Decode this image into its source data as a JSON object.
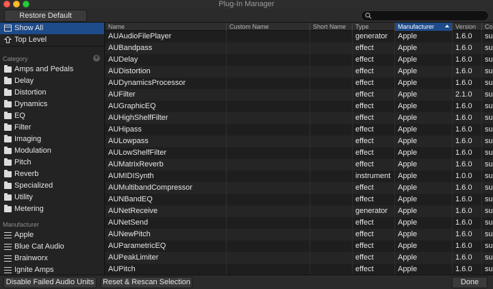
{
  "window": {
    "title": "Plug-In Manager"
  },
  "toolbar": {
    "restore_label": "Restore Default Settings",
    "search_placeholder": ""
  },
  "sidebar": {
    "show_all": "Show All",
    "top_level": "Top Level",
    "category_label": "Category",
    "categories": [
      "Amps and Pedals",
      "Delay",
      "Distortion",
      "Dynamics",
      "EQ",
      "Filter",
      "Imaging",
      "Modulation",
      "Pitch",
      "Reverb",
      "Specialized",
      "Utility",
      "Metering"
    ],
    "manufacturer_label": "Manufacturer",
    "manufacturers": [
      "Apple",
      "Blue Cat Audio",
      "Brainworx",
      "Ignite Amps"
    ]
  },
  "table": {
    "columns": [
      "Name",
      "Custom Name",
      "Short Name",
      "Type",
      "Manufacturer",
      "Version",
      "Co"
    ],
    "sorted_column": "Manufacturer",
    "rows": [
      [
        "AUAudioFilePlayer",
        "",
        "",
        "generator",
        "Apple",
        "1.6.0",
        "suc"
      ],
      [
        "AUBandpass",
        "",
        "",
        "effect",
        "Apple",
        "1.6.0",
        "suc"
      ],
      [
        "AUDelay",
        "",
        "",
        "effect",
        "Apple",
        "1.6.0",
        "suc"
      ],
      [
        "AUDistortion",
        "",
        "",
        "effect",
        "Apple",
        "1.6.0",
        "suc"
      ],
      [
        "AUDynamicsProcessor",
        "",
        "",
        "effect",
        "Apple",
        "1.6.0",
        "suc"
      ],
      [
        "AUFilter",
        "",
        "",
        "effect",
        "Apple",
        "2.1.0",
        "suc"
      ],
      [
        "AUGraphicEQ",
        "",
        "",
        "effect",
        "Apple",
        "1.6.0",
        "suc"
      ],
      [
        "AUHighShelfFilter",
        "",
        "",
        "effect",
        "Apple",
        "1.6.0",
        "suc"
      ],
      [
        "AUHipass",
        "",
        "",
        "effect",
        "Apple",
        "1.6.0",
        "suc"
      ],
      [
        "AULowpass",
        "",
        "",
        "effect",
        "Apple",
        "1.6.0",
        "suc"
      ],
      [
        "AULowShelfFilter",
        "",
        "",
        "effect",
        "Apple",
        "1.6.0",
        "suc"
      ],
      [
        "AUMatrixReverb",
        "",
        "",
        "effect",
        "Apple",
        "1.6.0",
        "suc"
      ],
      [
        "AUMIDISynth",
        "",
        "",
        "instrument",
        "Apple",
        "1.0.0",
        "suc"
      ],
      [
        "AUMultibandCompressor",
        "",
        "",
        "effect",
        "Apple",
        "1.6.0",
        "suc"
      ],
      [
        "AUNBandEQ",
        "",
        "",
        "effect",
        "Apple",
        "1.6.0",
        "suc"
      ],
      [
        "AUNetReceive",
        "",
        "",
        "generator",
        "Apple",
        "1.6.0",
        "suc"
      ],
      [
        "AUNetSend",
        "",
        "",
        "effect",
        "Apple",
        "1.6.0",
        "suc"
      ],
      [
        "AUNewPitch",
        "",
        "",
        "effect",
        "Apple",
        "1.6.0",
        "suc"
      ],
      [
        "AUParametricEQ",
        "",
        "",
        "effect",
        "Apple",
        "1.6.0",
        "suc"
      ],
      [
        "AUPeakLimiter",
        "",
        "",
        "effect",
        "Apple",
        "1.6.0",
        "suc"
      ],
      [
        "AUPitch",
        "",
        "",
        "effect",
        "Apple",
        "1.6.0",
        "suc"
      ]
    ]
  },
  "bottom": {
    "disable_label": "Disable Failed Audio Units",
    "rescan_label": "Reset & Rescan Selection",
    "done_label": "Done"
  }
}
